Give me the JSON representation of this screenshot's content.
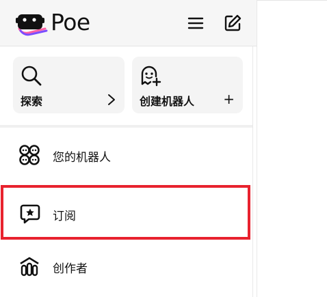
{
  "header": {
    "brand": "Poe",
    "menu_icon": "hamburger-menu-icon",
    "edit_icon": "compose-icon"
  },
  "cards": {
    "explore": {
      "label": "探索",
      "icon": "search-icon",
      "trail_icon": "chevron-right-icon"
    },
    "create": {
      "label": "创建机器人",
      "icon": "bot-add-icon",
      "trail": "+"
    }
  },
  "nav": {
    "items": [
      {
        "label": "您的机器人",
        "icon": "bots-grid-icon"
      },
      {
        "label": "订阅",
        "icon": "subscription-star-icon"
      },
      {
        "label": "创作者",
        "icon": "creators-icon"
      }
    ]
  },
  "colors": {
    "highlight": "#e8222e",
    "logo_purple": "#7c4dff",
    "logo_pink": "#ff5fa2"
  }
}
